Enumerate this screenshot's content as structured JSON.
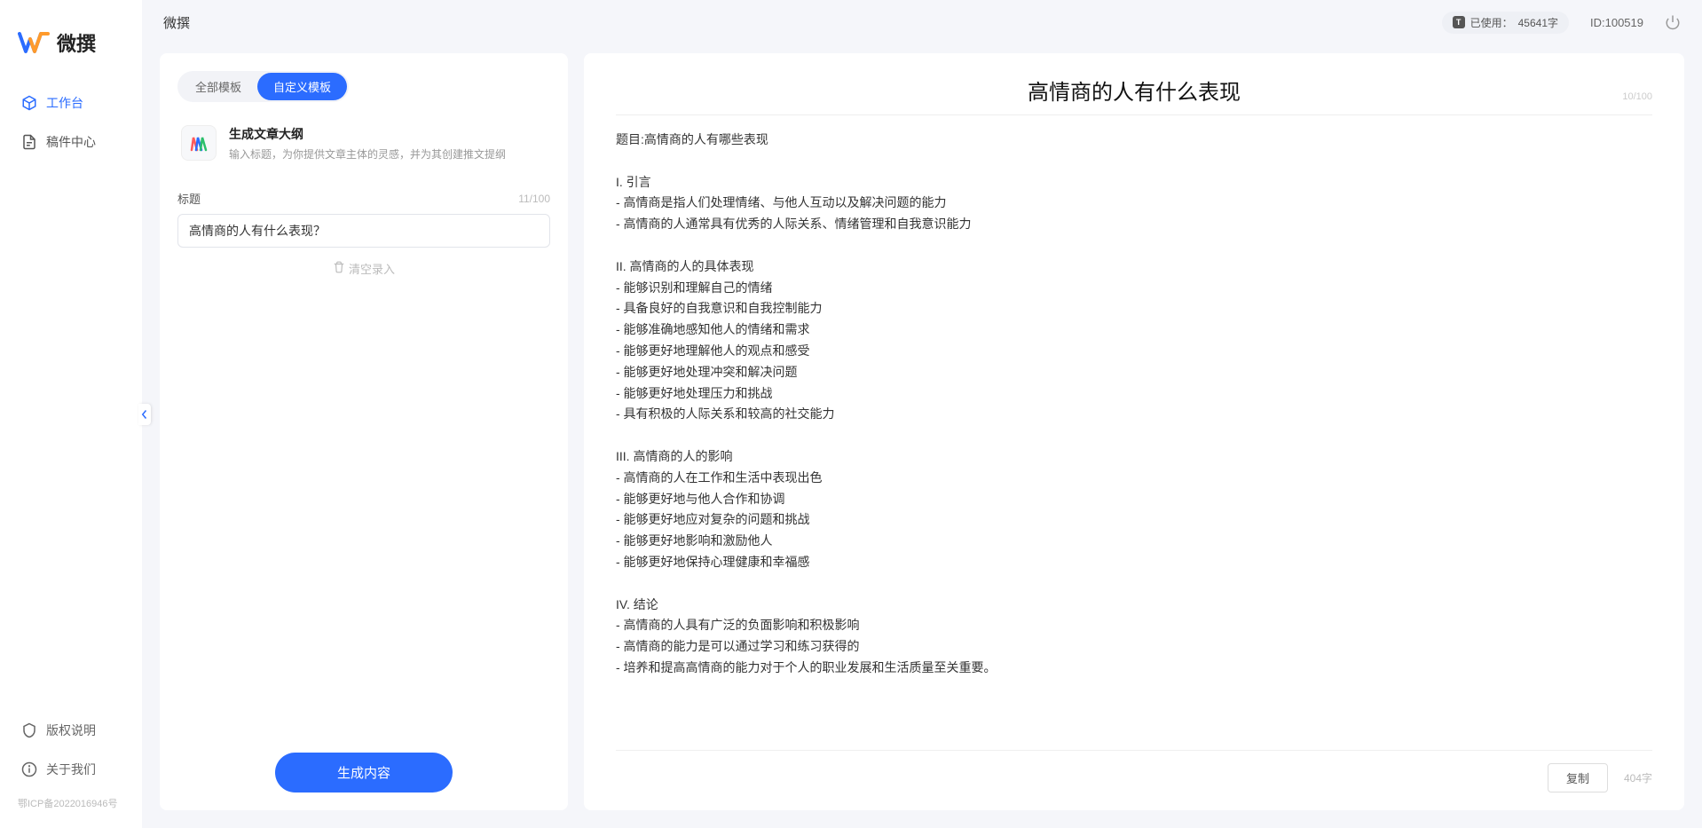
{
  "app": {
    "name": "微撰"
  },
  "logo": {
    "text": "微撰"
  },
  "sidebar": {
    "items": [
      {
        "label": "工作台",
        "icon": "cube-icon",
        "active": true
      },
      {
        "label": "稿件中心",
        "icon": "doc-icon",
        "active": false
      }
    ],
    "footer": [
      {
        "label": "版权说明",
        "icon": "shield-icon"
      },
      {
        "label": "关于我们",
        "icon": "info-icon"
      }
    ],
    "icp": "鄂ICP备2022016946号"
  },
  "topbar": {
    "usage_prefix": "已使用：",
    "usage_value": "45641字",
    "id_label": "ID:100519"
  },
  "left": {
    "tabs": [
      {
        "label": "全部模板",
        "active": false
      },
      {
        "label": "自定义模板",
        "active": true
      }
    ],
    "template": {
      "title": "生成文章大纲",
      "desc": "输入标题，为你提供文章主体的灵感，并为其创建推文提纲"
    },
    "form": {
      "label": "标题",
      "char_count": "11/100",
      "value": "高情商的人有什么表现？"
    },
    "clear_label": "清空录入",
    "generate_label": "生成内容"
  },
  "right": {
    "title": "高情商的人有什么表现",
    "title_count": "10/100",
    "body": "题目:高情商的人有哪些表现\n\nI. 引言\n- 高情商是指人们处理情绪、与他人互动以及解决问题的能力\n- 高情商的人通常具有优秀的人际关系、情绪管理和自我意识能力\n\nII. 高情商的人的具体表现\n- 能够识别和理解自己的情绪\n- 具备良好的自我意识和自我控制能力\n- 能够准确地感知他人的情绪和需求\n- 能够更好地理解他人的观点和感受\n- 能够更好地处理冲突和解决问题\n- 能够更好地处理压力和挑战\n- 具有积极的人际关系和较高的社交能力\n\nIII. 高情商的人的影响\n- 高情商的人在工作和生活中表现出色\n- 能够更好地与他人合作和协调\n- 能够更好地应对复杂的问题和挑战\n- 能够更好地影响和激励他人\n- 能够更好地保持心理健康和幸福感\n\nIV. 结论\n- 高情商的人具有广泛的负面影响和积极影响\n- 高情商的能力是可以通过学习和练习获得的\n- 培养和提高高情商的能力对于个人的职业发展和生活质量至关重要。",
    "copy_label": "复制",
    "word_count": "404字"
  }
}
